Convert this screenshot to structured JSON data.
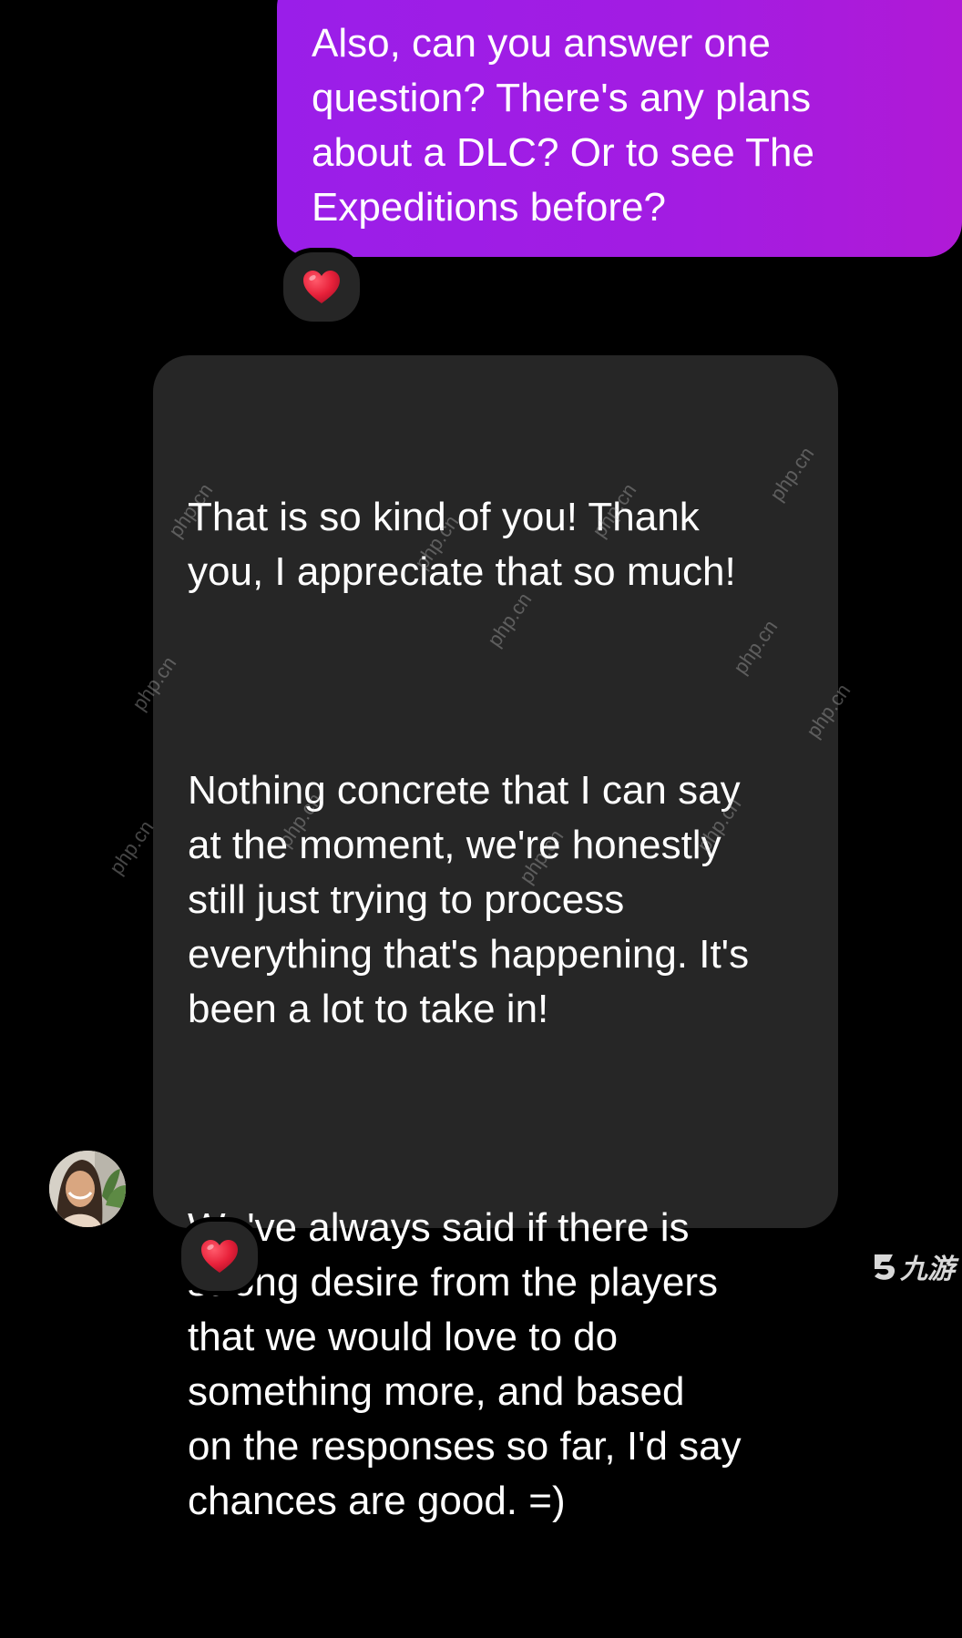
{
  "conversation": {
    "sent_message": {
      "text": "Also, can you answer one\nquestion? There's any plans\nabout a DLC? Or to see The\nExpeditions before?",
      "reaction": "heart-emoji"
    },
    "received_message": {
      "paragraphs": [
        "That is so kind of you! Thank\nyou, I appreciate that so much!",
        "Nothing concrete that I can say\nat the moment, we're honestly\nstill just trying to process\neverything that's happening. It's\nbeen a lot to take in!",
        "We've always said if there is\nstrong desire from the players\nthat we would love to do\nsomething more, and based\non the responses so far, I'd say\nchances are good. =)"
      ],
      "reaction": "heart-emoji"
    }
  },
  "watermark": {
    "text": "php.cn",
    "corner_logo": "九游"
  },
  "colors": {
    "background": "#000000",
    "sent_bubble_gradient_start": "#9a1ee9",
    "sent_bubble_gradient_end": "#b01ad6",
    "received_bubble": "#262626",
    "reaction_badge": "#262626",
    "heart": "#e8213a",
    "text": "#ffffff"
  }
}
